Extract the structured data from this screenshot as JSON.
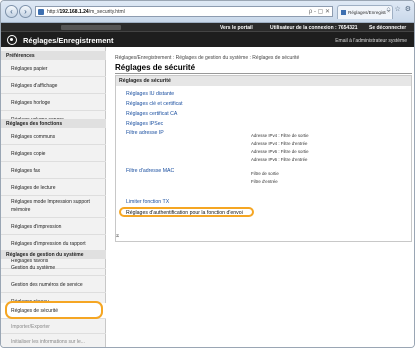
{
  "browser": {
    "url_prefix": "http://",
    "url_host": "192.168.1.24",
    "url_path": "/m_security.html",
    "tab_title": "Réglages/Enregistr...",
    "addr_icons": "ρ - ▢ ✕",
    "tools": "⌂ ☆ ⚙"
  },
  "header": {
    "portal_link": "Vers le portail",
    "user_info": "Utilisateur de la connexion :  7654321",
    "logout_link": "Se déconnecter",
    "app_title": "Réglages/Enregistrement",
    "admin_mail": "Email à l'administrateur système"
  },
  "sidebar": {
    "sections": [
      {
        "title": "Préférences",
        "items": [
          "Réglages papier",
          "Réglages d'affichage",
          "Réglages horloge",
          "Réglage volume sonore"
        ]
      },
      {
        "title": "Réglages des fonctions",
        "items": [
          "Réglages communs",
          "Réglages copie",
          "Réglages fax",
          "Réglages de lecture",
          "Réglages mode Impression support mémoire",
          "Réglages d'impression",
          "Réglages d'impression du rapport",
          "Réglages favoris"
        ]
      },
      {
        "title": "Réglages de gestion du système",
        "items": [
          "Gestion du système",
          "Gestion des numéros de service",
          "Réglages réseau",
          "Réglages de sécurité",
          "Importer/Exporter",
          "Initialiser les informations sur le..."
        ]
      }
    ]
  },
  "main": {
    "breadcrumb": "Réglages/Enregistrement : Réglages de gestion du système : Réglages de sécurité",
    "page_title": "Réglages de sécurité",
    "section_title": "Réglages de sécurité",
    "links": {
      "ip_remote": "Réglages IU distante",
      "key_cert": "Réglages clé et certificat",
      "cert_ca": "Réglages certificat CA",
      "ipsec": "Réglages IPSec",
      "ip_filter": "Filtre adresse IP",
      "mac_filter": "Filtre d'adresse MAC",
      "tx_limit": "Limiter fonction TX",
      "send_auth": "Réglages d'authentification pour la fonction d'envoi"
    },
    "ip_filters": [
      "Adresse IPv4 : Filtre de sortie",
      "Adresse IPv4 : Filtre d'entrée",
      "Adresse IPv6 : Filtre de sortie",
      "Adresse IPv6 : Filtre d'entrée"
    ],
    "mac_filters": [
      "Filtre de sortie",
      "Filtre d'entrée"
    ],
    "top_icon": "⌅"
  }
}
